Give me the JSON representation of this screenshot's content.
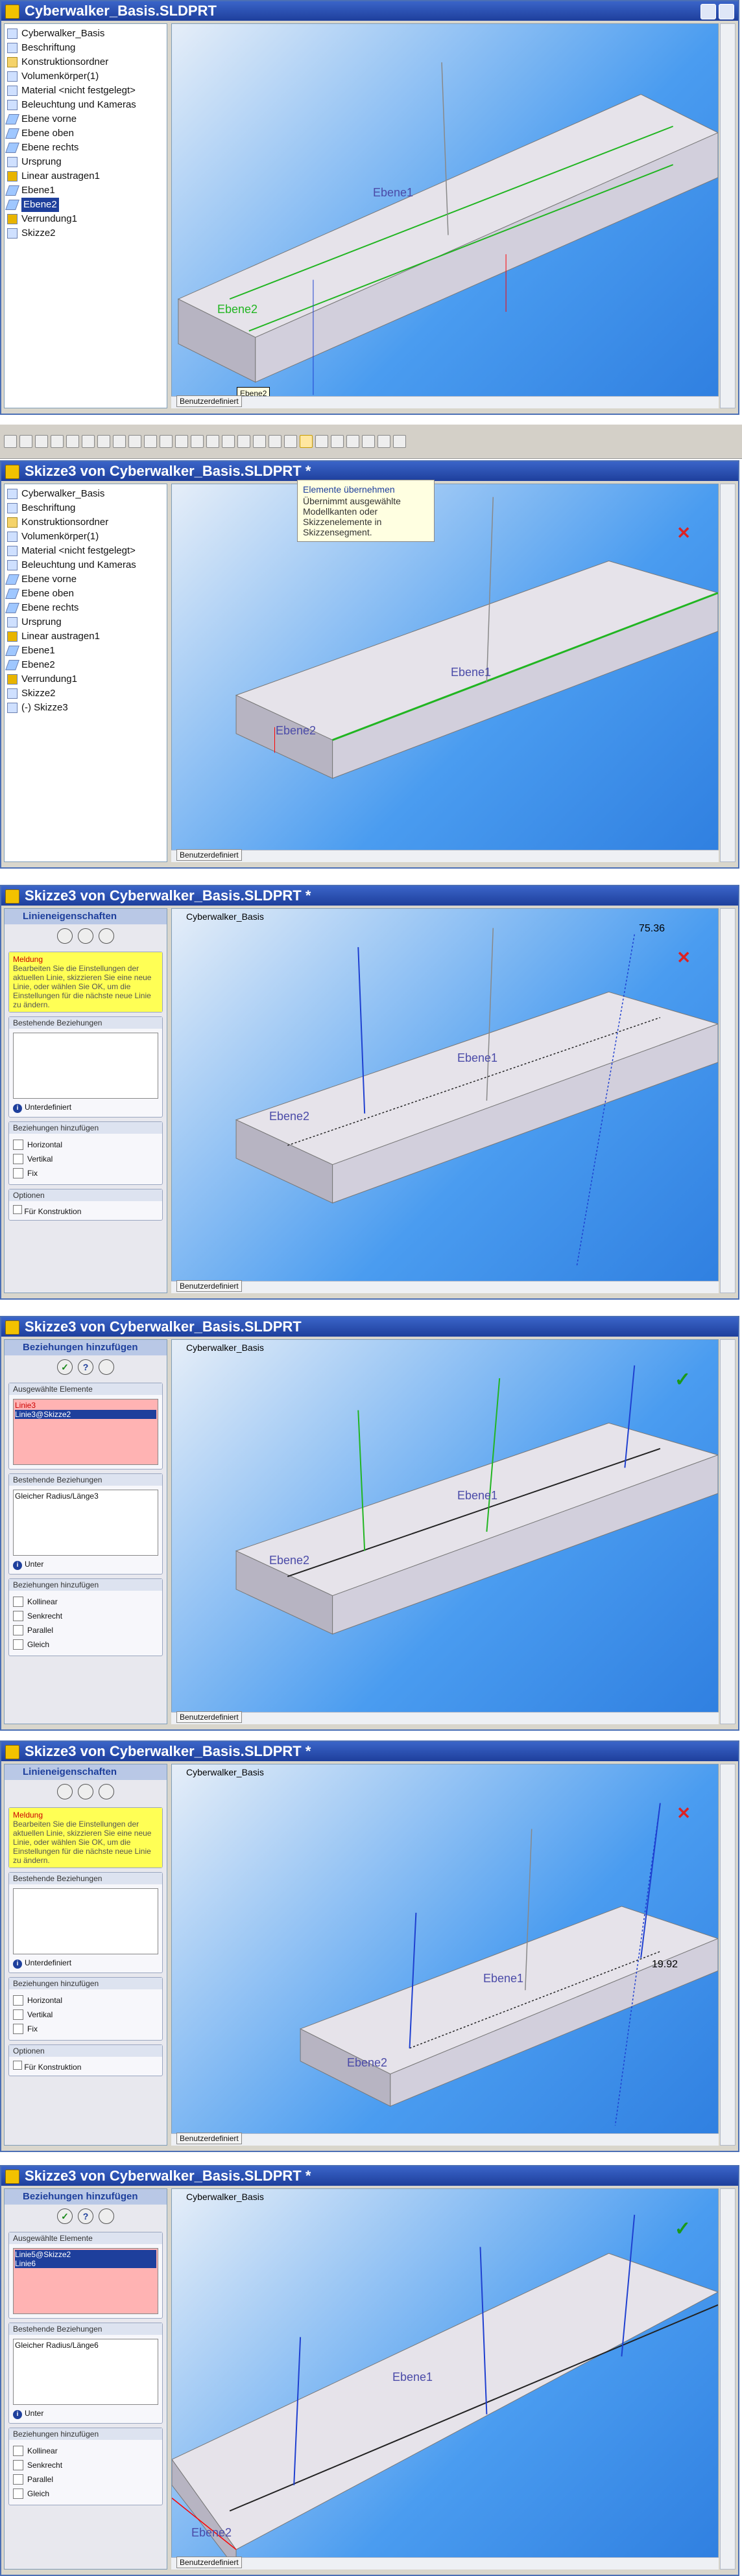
{
  "panels": [
    {
      "title": "Cyberwalker_Basis.SLDPRT",
      "tree": [
        {
          "label": "Cyberwalker_Basis",
          "icon": "part-icon"
        },
        {
          "label": "Beschriftung",
          "icon": "annotation-icon"
        },
        {
          "label": "Konstruktionsordner",
          "icon": "folder-icon"
        },
        {
          "label": "Volumenkörper(1)",
          "icon": "solid-bodies-icon"
        },
        {
          "label": "Material <nicht festgelegt>",
          "icon": "material-icon"
        },
        {
          "label": "Beleuchtung und Kameras",
          "icon": "lights-icon"
        },
        {
          "label": "Ebene vorne",
          "icon": "plane-icon"
        },
        {
          "label": "Ebene oben",
          "icon": "plane-icon"
        },
        {
          "label": "Ebene rechts",
          "icon": "plane-icon"
        },
        {
          "label": "Ursprung",
          "icon": "origin-icon"
        },
        {
          "label": "Linear austragen1",
          "icon": "extrude-icon"
        },
        {
          "label": "Ebene1",
          "icon": "plane-icon"
        },
        {
          "label": "Ebene2",
          "icon": "plane-icon",
          "selected": true
        },
        {
          "label": "Verrundung1",
          "icon": "fillet-icon"
        },
        {
          "label": "Skizze2",
          "icon": "sketch-icon"
        }
      ],
      "viewport_label": "Ebene1",
      "viewport_label2": "Ebene2",
      "tooltip": "Ebene2",
      "view_dropdown": "Benutzerdefiniert"
    },
    {
      "title": "Skizze3 von Cyberwalker_Basis.SLDPRT *",
      "tree": [
        {
          "label": "Cyberwalker_Basis",
          "icon": "part-icon"
        },
        {
          "label": "Beschriftung",
          "icon": "annotation-icon"
        },
        {
          "label": "Konstruktionsordner",
          "icon": "folder-icon"
        },
        {
          "label": "Volumenkörper(1)",
          "icon": "solid-bodies-icon"
        },
        {
          "label": "Material <nicht festgelegt>",
          "icon": "material-icon"
        },
        {
          "label": "Beleuchtung und Kameras",
          "icon": "lights-icon"
        },
        {
          "label": "Ebene vorne",
          "icon": "plane-icon"
        },
        {
          "label": "Ebene oben",
          "icon": "plane-icon"
        },
        {
          "label": "Ebene rechts",
          "icon": "plane-icon"
        },
        {
          "label": "Ursprung",
          "icon": "origin-icon"
        },
        {
          "label": "Linear austragen1",
          "icon": "extrude-icon"
        },
        {
          "label": "Ebene1",
          "icon": "plane-icon"
        },
        {
          "label": "Ebene2",
          "icon": "plane-icon"
        },
        {
          "label": "Verrundung1",
          "icon": "fillet-icon"
        },
        {
          "label": "Skizze2",
          "icon": "sketch-icon"
        },
        {
          "label": "(-) Skizze3",
          "icon": "sketch-icon"
        }
      ],
      "viewport_label": "Ebene1",
      "viewport_label2": "Ebene2",
      "view_dropdown": "Benutzerdefiniert",
      "tooltip_title": "Elemente übernehmen",
      "tooltip_body": "Übernimmt ausgewählte Modellkanten oder Skizzenelemente in Skizzensegment."
    },
    {
      "title": "Skizze3 von Cyberwalker_Basis.SLDPRT *",
      "pm_title": "Linieneigenschaften",
      "message_header": "Meldung",
      "message": "Bearbeiten Sie die Einstellungen der aktuellen Linie, skizzieren Sie eine neue Linie, oder wählen Sie OK, um die Einstellungen für die nächste neue Linie zu ändern.",
      "existing_header": "Bestehende Beziehungen",
      "status": "Unterdefiniert",
      "add_header": "Beziehungen hinzufügen",
      "relations": [
        "Horizontal",
        "Vertikal",
        "Fix"
      ],
      "options_header": "Optionen",
      "option": "Für Konstruktion",
      "model_name": "Cyberwalker_Basis",
      "viewport_label": "Ebene1",
      "viewport_label2": "Ebene2",
      "dimension": "75.36",
      "view_dropdown": "Benutzerdefiniert"
    },
    {
      "title": "Skizze3 von Cyberwalker_Basis.SLDPRT",
      "pm_title": "Beziehungen hinzufügen",
      "selected_header": "Ausgewählte Elemente",
      "selected": [
        "Linie3",
        "Linie3@Skizze2"
      ],
      "existing_header": "Bestehende Beziehungen",
      "existing": [
        "Gleicher Radius/Länge3"
      ],
      "status": "Unter",
      "add_header": "Beziehungen hinzufügen",
      "relations": [
        "Kollinear",
        "Senkrecht",
        "Parallel",
        "Gleich"
      ],
      "model_name": "Cyberwalker_Basis",
      "viewport_label": "Ebene1",
      "viewport_label2": "Ebene2",
      "view_dropdown": "Benutzerdefiniert"
    },
    {
      "title": "Skizze3 von Cyberwalker_Basis.SLDPRT *",
      "pm_title": "Linieneigenschaften",
      "message_header": "Meldung",
      "message": "Bearbeiten Sie die Einstellungen der aktuellen Linie, skizzieren Sie eine neue Linie, oder wählen Sie OK, um die Einstellungen für die nächste neue Linie zu ändern.",
      "existing_header": "Bestehende Beziehungen",
      "status": "Unterdefiniert",
      "add_header": "Beziehungen hinzufügen",
      "relations": [
        "Horizontal",
        "Vertikal",
        "Fix"
      ],
      "options_header": "Optionen",
      "option": "Für Konstruktion",
      "model_name": "Cyberwalker_Basis",
      "viewport_label": "Ebene1",
      "viewport_label2": "Ebene2",
      "dimension": "19.92",
      "view_dropdown": "Benutzerdefiniert"
    },
    {
      "title": "Skizze3 von Cyberwalker_Basis.SLDPRT *",
      "pm_title": "Beziehungen hinzufügen",
      "selected_header": "Ausgewählte Elemente",
      "selected": [
        "Linie5@Skizze2",
        "Linie6"
      ],
      "existing_header": "Bestehende Beziehungen",
      "existing": [
        "Gleicher Radius/Länge6"
      ],
      "status": "Unter",
      "add_header": "Beziehungen hinzufügen",
      "relations": [
        "Kollinear",
        "Senkrecht",
        "Parallel",
        "Gleich"
      ],
      "model_name": "Cyberwalker_Basis",
      "viewport_label": "Ebene1",
      "viewport_label2": "Ebene2",
      "view_dropdown": "Benutzerdefiniert"
    }
  ],
  "colors": {
    "title_bar": "#1e3f9c",
    "viewport": "#4a9cf0",
    "message_bg": "#ffff55",
    "selection_bg": "#ffb3b3",
    "ok_green": "#1a8a1a",
    "sketch_blue": "#1e3fd0",
    "sketch_green": "#21b521"
  }
}
